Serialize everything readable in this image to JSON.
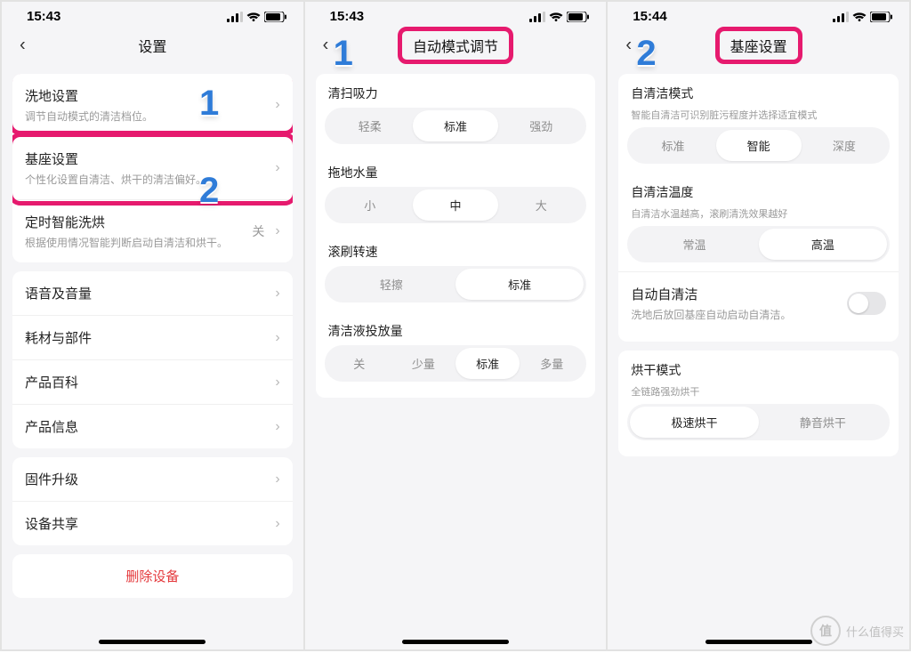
{
  "status": {
    "time1": "15:43",
    "time2": "15:43",
    "time3": "15:44"
  },
  "panel1": {
    "title": "设置",
    "rows": {
      "wash": {
        "title": "洗地设置",
        "sub": "调节自动模式的清洁档位。"
      },
      "base": {
        "title": "基座设置",
        "sub": "个性化设置自清洁、烘干的清洁偏好。"
      },
      "schedule": {
        "title": "定时智能洗烘",
        "sub": "根据使用情况智能判断启动自清洁和烘干。",
        "value": "关"
      },
      "voice": {
        "title": "语音及音量"
      },
      "parts": {
        "title": "耗材与部件"
      },
      "wiki": {
        "title": "产品百科"
      },
      "info": {
        "title": "产品信息"
      },
      "fw": {
        "title": "固件升级"
      },
      "share": {
        "title": "设备共享"
      }
    },
    "delete": "删除设备",
    "callouts": {
      "n1": "1",
      "n2": "2"
    }
  },
  "panel2": {
    "title": "自动模式调节",
    "callout": "1",
    "suction": {
      "label": "清扫吸力",
      "opts": [
        "轻柔",
        "标准",
        "强劲"
      ],
      "on": 1
    },
    "water": {
      "label": "拖地水量",
      "opts": [
        "小",
        "中",
        "大"
      ],
      "on": 1
    },
    "roller": {
      "label": "滚刷转速",
      "opts": [
        "轻擦",
        "标准"
      ],
      "on": 1
    },
    "liquid": {
      "label": "清洁液投放量",
      "opts": [
        "关",
        "少量",
        "标准",
        "多量"
      ],
      "on": 2
    }
  },
  "panel3": {
    "title": "基座设置",
    "callout": "2",
    "mode": {
      "label": "自清洁模式",
      "sub": "智能自清洁可识别脏污程度并选择适宜模式",
      "opts": [
        "标准",
        "智能",
        "深度"
      ],
      "on": 1
    },
    "temp": {
      "label": "自清洁温度",
      "sub": "自清洁水温越高，滚刷清洗效果越好",
      "opts": [
        "常温",
        "高温"
      ],
      "on": 1
    },
    "auto": {
      "label": "自动自清洁",
      "sub": "洗地后放回基座自动启动自清洁。"
    },
    "dry": {
      "label": "烘干模式",
      "sub": "全链路强劲烘干",
      "opts": [
        "极速烘干",
        "静音烘干"
      ],
      "on": 0
    }
  },
  "watermark": "什么值得买"
}
